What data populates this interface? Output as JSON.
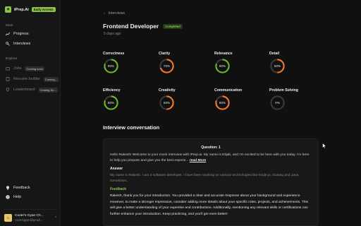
{
  "brand": {
    "name": "iPrep.Ai",
    "badge": "Early Access"
  },
  "sidebar": {
    "section_main": "Main",
    "main_items": [
      {
        "label": "Progress",
        "icon": "trend-icon"
      },
      {
        "label": "Interviews",
        "icon": "mic-icon"
      }
    ],
    "section_explore": "Explore",
    "explore_items": [
      {
        "label": "Jobs",
        "soon": "Coming soon",
        "icon": "briefcase-icon"
      },
      {
        "label": "Resume builder",
        "soon": "Coming...",
        "icon": "document-icon"
      },
      {
        "label": "Leaderboard",
        "soon": "Coming So...",
        "icon": "trophy-icon"
      }
    ],
    "bottom_items": [
      {
        "label": "Feedback",
        "icon": "bulb-icon"
      },
      {
        "label": "Help",
        "icon": "help-icon"
      }
    ],
    "user": {
      "name": "Coder's Gyan Ch...",
      "email": "codersgyan@gmail..."
    }
  },
  "header": {
    "breadcrumb": "Interviews",
    "title": "Frontend Developer",
    "status": "Completed",
    "subtitle": "5 days ago"
  },
  "metrics": [
    {
      "label": "Correctness",
      "value": "80%",
      "percent": 80,
      "color": "#6ab82a"
    },
    {
      "label": "Clarity",
      "value": "70%",
      "percent": 70,
      "color": "#f07a2c"
    },
    {
      "label": "Relevance",
      "value": "80%",
      "percent": 80,
      "color": "#6ab82a"
    },
    {
      "label": "Detail",
      "value": "50%",
      "percent": 50,
      "color": "#f07a2c"
    },
    {
      "label": "Efficiency",
      "value": "80%",
      "percent": 80,
      "color": "#6ab82a"
    },
    {
      "label": "Creativity",
      "value": "50%",
      "percent": 50,
      "color": "#f07a2c"
    },
    {
      "label": "Communication",
      "value": "80%",
      "percent": 80,
      "color": "#f07a2c"
    },
    {
      "label": "Problem Solving",
      "value": "0%",
      "percent": 0,
      "color": "#f07a2c"
    }
  ],
  "conversation": {
    "title": "Interview conversation",
    "question_label": "Question: 1",
    "question_text": "Hello Rakesh! Welcome to your mock interview with iPrep.ai. My name is Elijah, and I'm excited to be here with you today. I'm here to help you prepare and give you the best experie...",
    "read_more": "read More",
    "answer_label": "Answer",
    "answer_text": "My name is Rakesh. I am a software developer. I have been working on various technologies like Node.js, Golang and Java sometimes.",
    "feedback_label": "Feedback",
    "feedback_text": "Rakesh, thank you for your introduction. You provided a clear and accurate response about your background and experience. However, to make a stronger impression, consider adding more details about your specific roles, projects, and achievements. This will give a better understanding of your expertise and contributions. Additionally, mentioning any relevant skills or certifications can further enhance your introduction. Keep practicing, and you'll get even better!"
  },
  "colors": {
    "accent": "#8bc34a",
    "green": "#6ab82a",
    "orange": "#f07a2c",
    "track": "#3a3a3a"
  }
}
